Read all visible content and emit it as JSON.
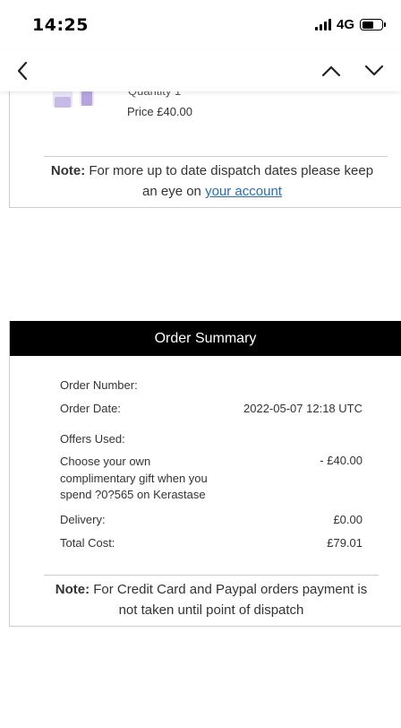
{
  "status_bar": {
    "time": "14:25",
    "network": "4G",
    "battery_level": 0.6
  },
  "nav": {
    "back_icon": "chevron-left-icon",
    "prev_icon": "chevron-up-icon",
    "next_icon": "chevron-down-icon"
  },
  "product": {
    "quantity": "Quantity 1",
    "price": "Price £40.00"
  },
  "dispatch_note": {
    "label": "Note:",
    "text": " For more up to date dispatch dates please keep an eye on ",
    "link": "your account",
    "link_color": "#2a6db5"
  },
  "summary": {
    "title": "Order Summary",
    "order_number_label": "Order Number:",
    "order_number_value": "",
    "order_date_label": "Order Date:",
    "order_date_value": "2022-05-07 12:18 UTC",
    "offers_label": "Offers Used:",
    "offer_desc": "Choose your own complimentary gift when you spend ?0?565 on Kerastase",
    "offer_value": "- £40.00",
    "delivery_label": "Delivery:",
    "delivery_value": "£0.00",
    "total_label": "Total Cost:",
    "total_value": "£79.01",
    "note_label": "Note:",
    "note_text": " For Credit Card and Paypal orders payment is not taken until point of dispatch"
  }
}
